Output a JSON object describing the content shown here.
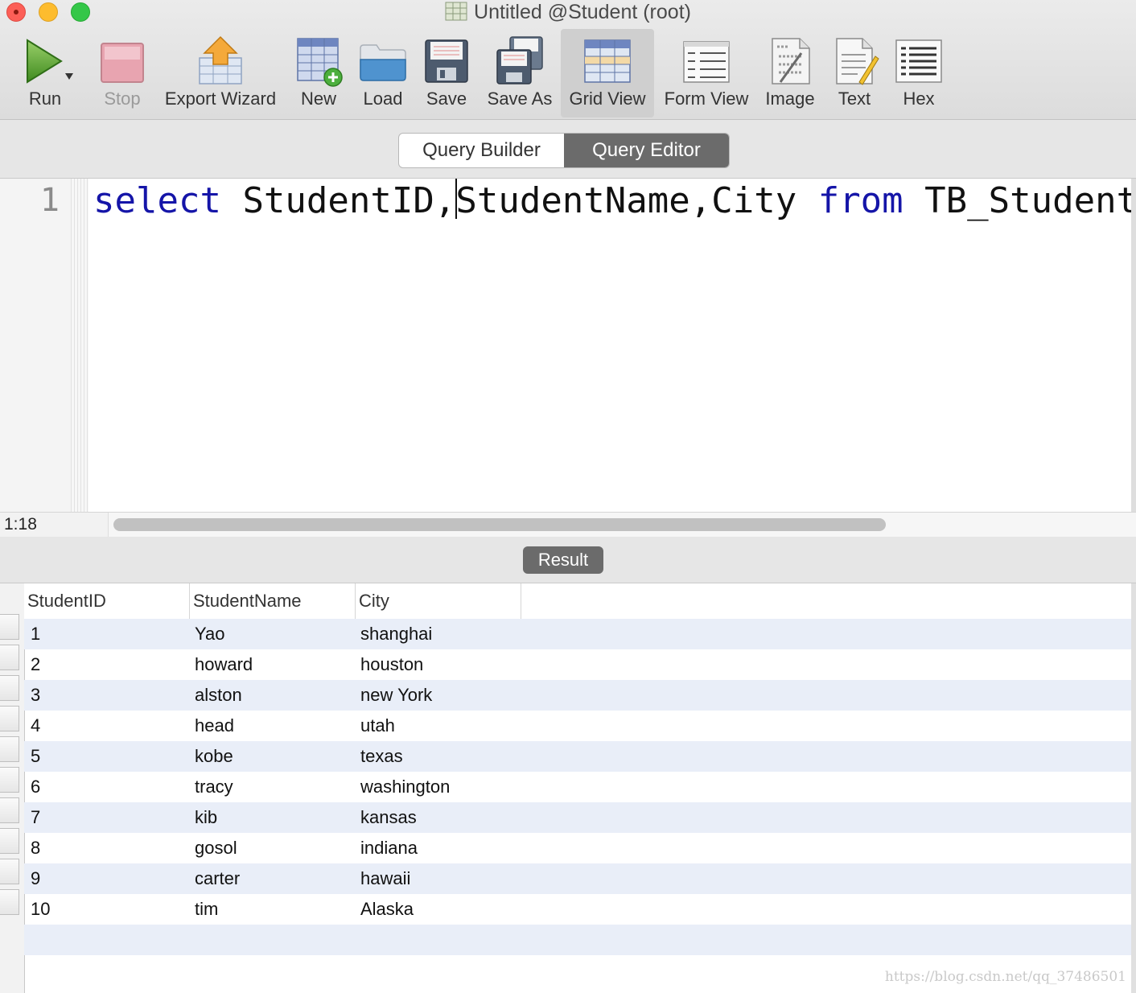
{
  "window": {
    "title": "Untitled @Student (root)"
  },
  "toolbar": {
    "run": "Run",
    "stop": "Stop",
    "export_wizard": "Export Wizard",
    "new": "New",
    "load": "Load",
    "save": "Save",
    "save_as": "Save As",
    "grid_view": "Grid View",
    "form_view": "Form View",
    "image": "Image",
    "text": "Text",
    "hex": "Hex"
  },
  "mode_tabs": {
    "query_builder": "Query Builder",
    "query_editor": "Query Editor",
    "selected": "Query Editor"
  },
  "editor": {
    "line_number": "1",
    "code_tokens": {
      "kw_select": "select",
      "before_caret": " StudentID,",
      "after_caret": "StudentName,City ",
      "kw_from": "from",
      "rest": " TB_Student;"
    },
    "cursor_position": "1:18"
  },
  "result": {
    "tab_label": "Result",
    "columns": [
      "StudentID",
      "StudentName",
      "City"
    ],
    "rows": [
      [
        "1",
        "Yao",
        "shanghai"
      ],
      [
        "2",
        "howard",
        "houston"
      ],
      [
        "3",
        "alston",
        "new York"
      ],
      [
        "4",
        "head",
        "utah"
      ],
      [
        "5",
        "kobe",
        "texas"
      ],
      [
        "6",
        "tracy",
        "washington"
      ],
      [
        "7",
        "kib",
        "kansas"
      ],
      [
        "8",
        "gosol",
        "indiana"
      ],
      [
        "9",
        "carter",
        "hawaii"
      ],
      [
        "10",
        "tim",
        "Alaska"
      ]
    ]
  },
  "watermark": "https://blog.csdn.net/qq_37486501",
  "colors": {
    "keyword": "#1515a8",
    "selected_segment": "#6b6b6b",
    "alt_row": "#e9eef8"
  }
}
